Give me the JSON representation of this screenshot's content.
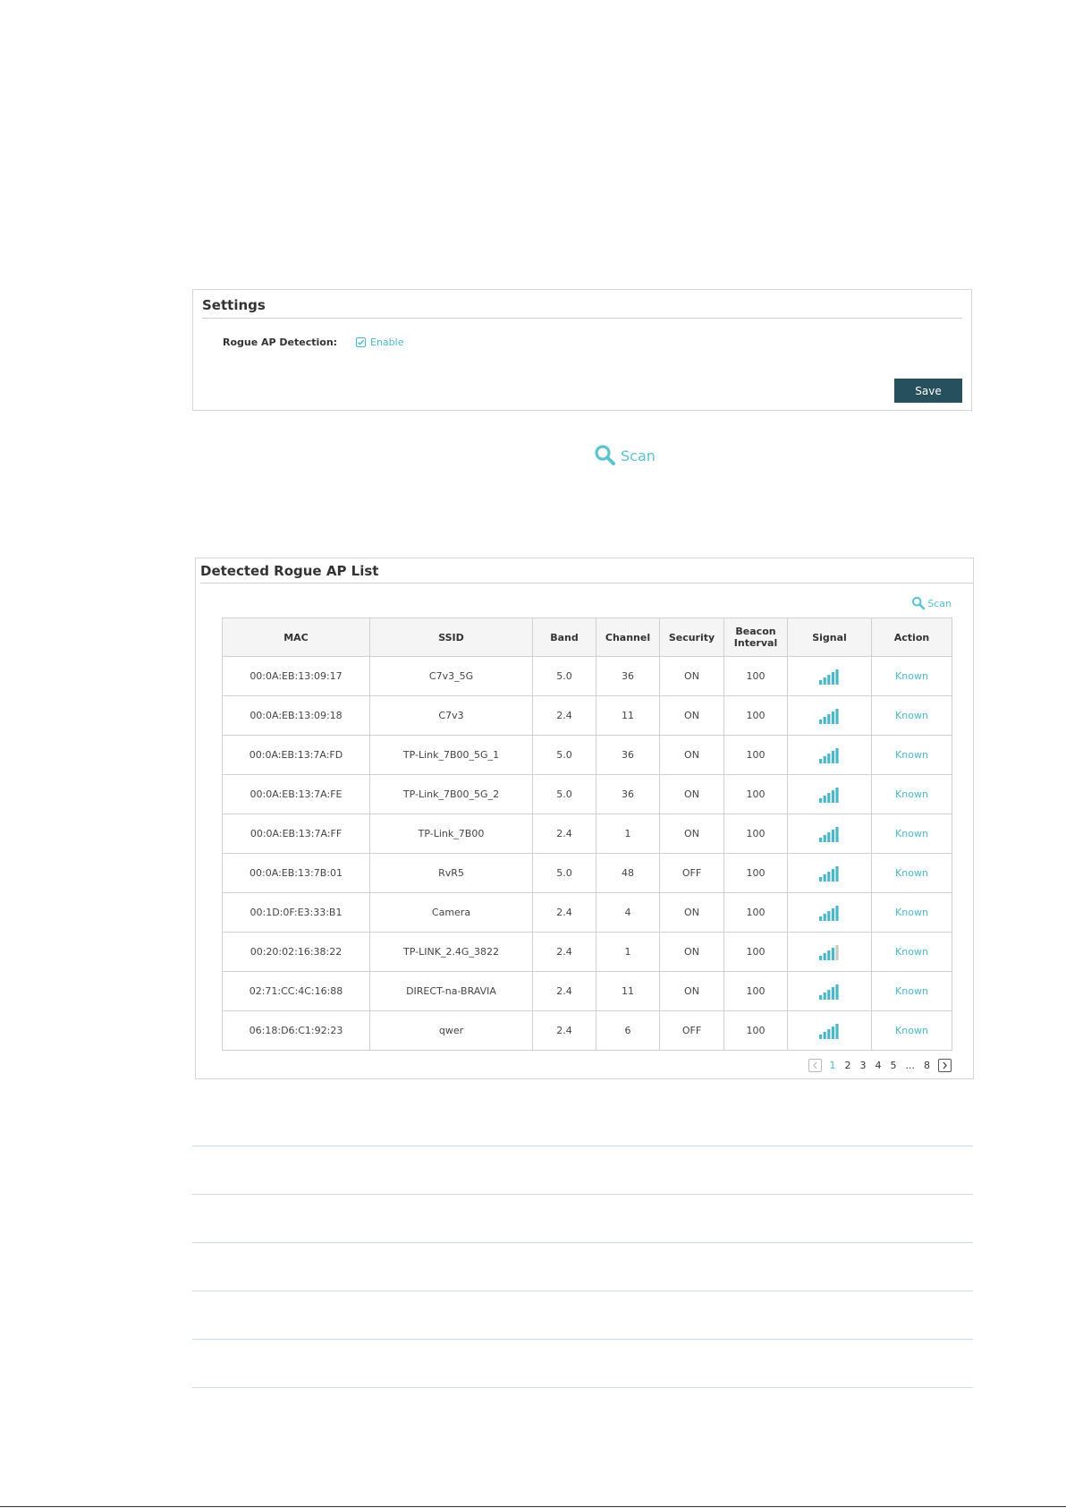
{
  "settings": {
    "title": "Settings",
    "rogue_label": "Rogue AP Detection:",
    "enable_label": "Enable",
    "enable_checked": true,
    "save_label": "Save"
  },
  "scan_standalone": {
    "label": "Scan"
  },
  "ap_list": {
    "title": "Detected Rogue AP List",
    "scan_label": "Scan",
    "columns": {
      "mac": "MAC",
      "ssid": "SSID",
      "band": "Band",
      "channel": "Channel",
      "security": "Security",
      "beacon_line1": "Beacon",
      "beacon_line2": "Interval",
      "signal": "Signal",
      "action": "Action"
    },
    "rows": [
      {
        "mac": "00:0A:EB:13:09:17",
        "ssid": "C7v3_5G",
        "band": "5.0",
        "channel": "36",
        "security": "ON",
        "beacon": "100",
        "signal": 5,
        "action": "Known"
      },
      {
        "mac": "00:0A:EB:13:09:18",
        "ssid": "C7v3",
        "band": "2.4",
        "channel": "11",
        "security": "ON",
        "beacon": "100",
        "signal": 5,
        "action": "Known"
      },
      {
        "mac": "00:0A:EB:13:7A:FD",
        "ssid": "TP-Link_7B00_5G_1",
        "band": "5.0",
        "channel": "36",
        "security": "ON",
        "beacon": "100",
        "signal": 5,
        "action": "Known"
      },
      {
        "mac": "00:0A:EB:13:7A:FE",
        "ssid": "TP-Link_7B00_5G_2",
        "band": "5.0",
        "channel": "36",
        "security": "ON",
        "beacon": "100",
        "signal": 5,
        "action": "Known"
      },
      {
        "mac": "00:0A:EB:13:7A:FF",
        "ssid": "TP-Link_7B00",
        "band": "2.4",
        "channel": "1",
        "security": "ON",
        "beacon": "100",
        "signal": 5,
        "action": "Known"
      },
      {
        "mac": "00:0A:EB:13:7B:01",
        "ssid": "RvR5",
        "band": "5.0",
        "channel": "48",
        "security": "OFF",
        "beacon": "100",
        "signal": 5,
        "action": "Known"
      },
      {
        "mac": "00:1D:0F:E3:33:B1",
        "ssid": "Camera",
        "band": "2.4",
        "channel": "4",
        "security": "ON",
        "beacon": "100",
        "signal": 5,
        "action": "Known"
      },
      {
        "mac": "00:20:02:16:38:22",
        "ssid": "TP-LINK_2.4G_3822",
        "band": "2.4",
        "channel": "1",
        "security": "ON",
        "beacon": "100",
        "signal": 4,
        "action": "Known"
      },
      {
        "mac": "02:71:CC:4C:16:88",
        "ssid": "DIRECT-na-BRAVIA",
        "band": "2.4",
        "channel": "11",
        "security": "ON",
        "beacon": "100",
        "signal": 5,
        "action": "Known"
      },
      {
        "mac": "06:18:D6:C1:92:23",
        "ssid": "qwer",
        "band": "2.4",
        "channel": "6",
        "security": "OFF",
        "beacon": "100",
        "signal": 5,
        "action": "Known"
      }
    ],
    "pagination": {
      "pages": [
        "1",
        "2",
        "3",
        "4",
        "5",
        "...",
        "8"
      ],
      "current": "1"
    }
  },
  "colors": {
    "accent": "#4ab8c8",
    "save_button": "#27505f",
    "signal_on": "#4ab8c8",
    "signal_off": "#c8c8c8"
  }
}
